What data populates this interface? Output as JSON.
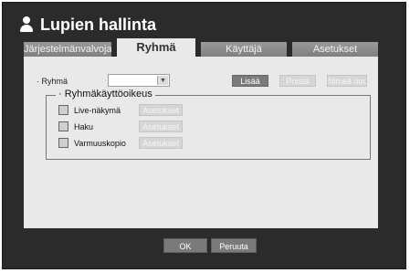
{
  "window": {
    "title": "Lupien hallinta",
    "title_icon": "user-icon"
  },
  "tabs": [
    {
      "label": "Järjestelmänvalvoja",
      "active": false
    },
    {
      "label": "Ryhmä",
      "active": true
    },
    {
      "label": "Käyttäjä",
      "active": false
    },
    {
      "label": "Asetukset",
      "active": false
    }
  ],
  "group_row": {
    "label": "· Ryhmä",
    "select_value": "",
    "add_label": "Lisää",
    "delete_label": "Poista",
    "rename_label": "Nimeä uudelleen"
  },
  "permissions": {
    "legend": "· Ryhmäkäyttöoikeus",
    "items": [
      {
        "label": "Live-näkymä",
        "button": "Asetukset",
        "checked": false
      },
      {
        "label": "Haku",
        "button": "Asetukset",
        "checked": false
      },
      {
        "label": "Varmuuskopio",
        "button": "Asetukset",
        "checked": false
      }
    ]
  },
  "footer": {
    "ok_label": "OK",
    "cancel_label": "Peruuta"
  }
}
